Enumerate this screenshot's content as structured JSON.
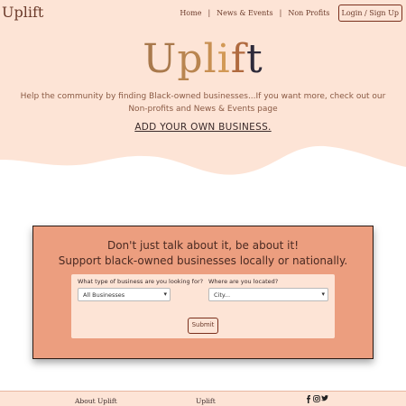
{
  "navbar": {
    "brand": "Uplift",
    "links": [
      "Home",
      "News & Events",
      "Non Profits"
    ],
    "separator": "|",
    "login_label": "Login / Sign Up"
  },
  "hero": {
    "logo": [
      "U",
      "p",
      "l",
      "i",
      "f",
      "t"
    ],
    "tagline": "Help the community by finding Black-owned businesses...If you want more, check out our Non-profits and News & Events page",
    "add_business_link": "ADD YOUR OWN BUSINESS."
  },
  "search": {
    "heading_line1": "Don't just talk about it, be about it!",
    "heading_line2": "Support black-owned businesses locally or nationally.",
    "type_label": "What type of business are you looking for?",
    "type_selected": "All Businesses",
    "location_label": "Where are you located?",
    "location_selected": "City...",
    "submit_label": "Submit"
  },
  "footer": {
    "about": "About Uplift",
    "brand": "Uplift",
    "social_icons": [
      "facebook-icon",
      "instagram-icon",
      "twitter-icon"
    ]
  },
  "colors": {
    "hero_bg": "#fde4d6",
    "card_bg": "#ec9e7f",
    "accent_border": "#7a2f1c",
    "text_brown": "#6b3a2a"
  }
}
